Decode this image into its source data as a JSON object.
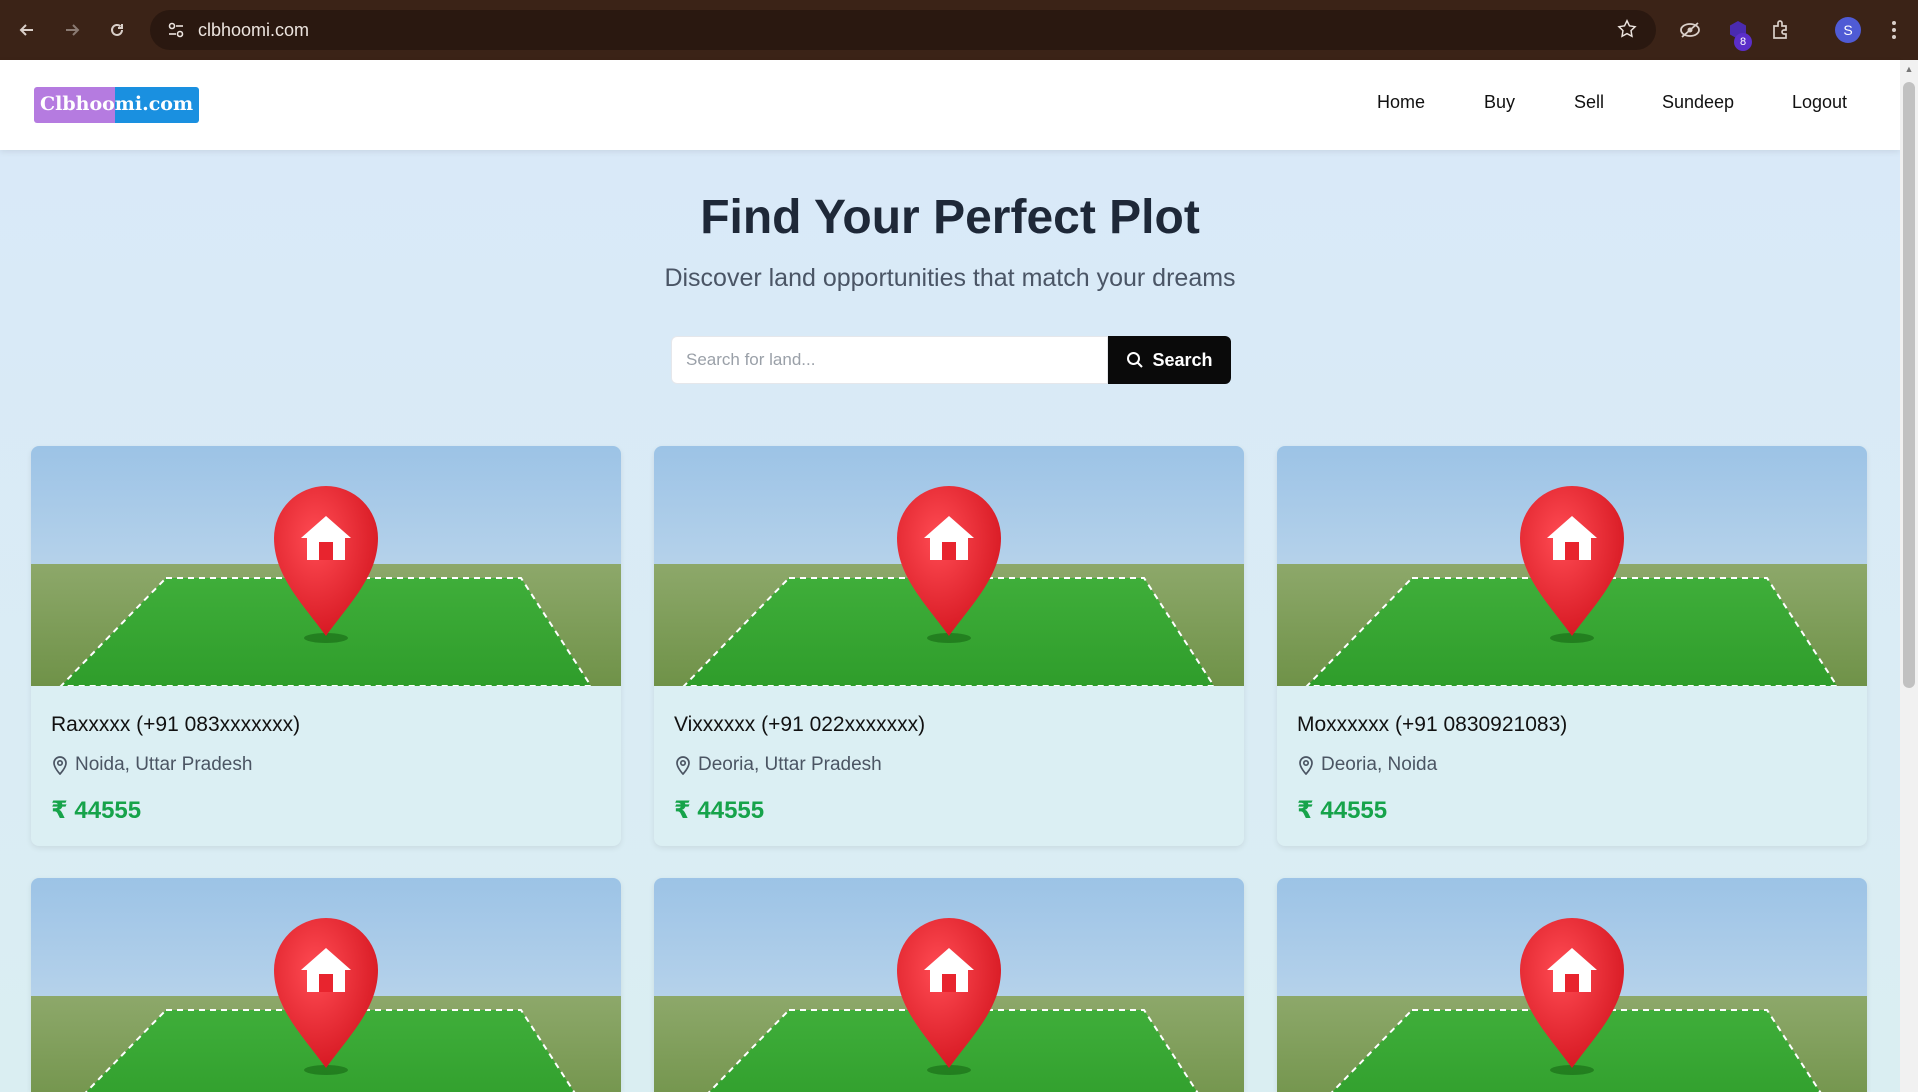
{
  "browser": {
    "url": "clbhoomi.com",
    "profile_initial": "S",
    "extension_badge": "8"
  },
  "site": {
    "logo_part1": "Clbhoo",
    "logo_part2": "mi.com",
    "nav": [
      "Home",
      "Buy",
      "Sell",
      "Sundeep",
      "Logout"
    ]
  },
  "hero": {
    "title": "Find Your Perfect Plot",
    "subtitle": "Discover land opportunities that match your dreams"
  },
  "search": {
    "placeholder": "Search for land...",
    "button_label": "Search"
  },
  "listings": [
    {
      "name": "Raxxxxx (+91 083xxxxxxx)",
      "location": "Noida, Uttar Pradesh",
      "price": "₹ 44555"
    },
    {
      "name": "Vixxxxxx (+91 022xxxxxxx)",
      "location": "Deoria, Uttar Pradesh",
      "price": "₹ 44555"
    },
    {
      "name": "Moxxxxxx (+91 0830921083)",
      "location": "Deoria, Noida",
      "price": "₹ 44555"
    }
  ],
  "colors": {
    "price": "#16a34a",
    "search_button": "#0a0a0a",
    "chrome": "#3b2317",
    "pin": "#e8242e"
  }
}
